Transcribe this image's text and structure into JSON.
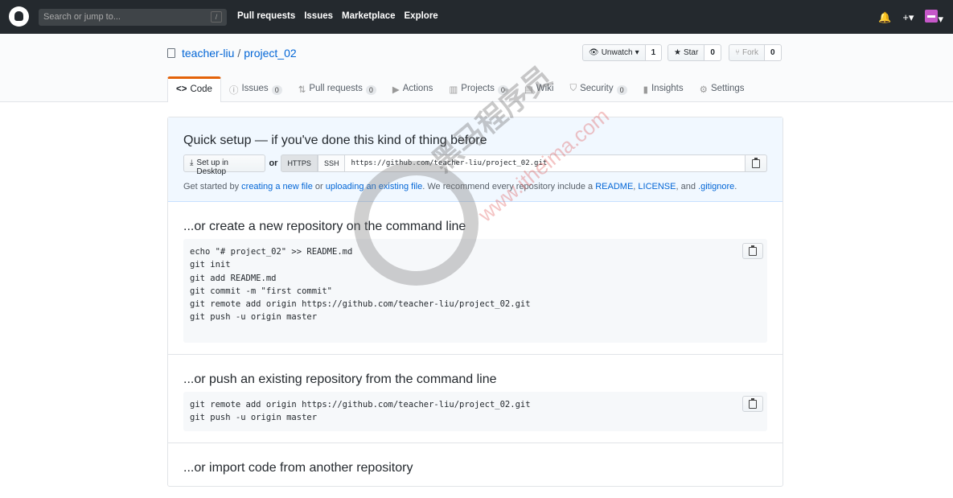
{
  "header": {
    "search_placeholder": "Search or jump to...",
    "slash_key": "/",
    "nav": [
      "Pull requests",
      "Issues",
      "Marketplace",
      "Explore"
    ],
    "icons": [
      "bell-icon",
      "plus-icon",
      "avatar"
    ]
  },
  "repo": {
    "owner": "teacher-liu",
    "separator": "/",
    "name": "project_02",
    "watch_label": "Unwatch",
    "watch_count": "1",
    "star_label": "Star",
    "star_count": "0",
    "fork_label": "Fork",
    "fork_count": "0"
  },
  "tabs": [
    {
      "icon": "<>",
      "label": "Code",
      "counter": ""
    },
    {
      "icon": "ⓘ",
      "label": "Issues",
      "counter": "0"
    },
    {
      "icon": "⇅",
      "label": "Pull requests",
      "counter": "0"
    },
    {
      "icon": "▶",
      "label": "Actions",
      "counter": ""
    },
    {
      "icon": "▥",
      "label": "Projects",
      "counter": "0"
    },
    {
      "icon": "▤",
      "label": "Wiki",
      "counter": ""
    },
    {
      "icon": "⛉",
      "label": "Security",
      "counter": "0"
    },
    {
      "icon": "▮",
      "label": "Insights",
      "counter": ""
    },
    {
      "icon": "⚙",
      "label": "Settings",
      "counter": ""
    }
  ],
  "setup": {
    "title": "Quick setup — if you've done this kind of thing before",
    "desktop_btn": "Set up in Desktop",
    "or": "or",
    "https": "HTTPS",
    "ssh": "SSH",
    "url": "https://github.com/teacher-liu/project_02.git",
    "hint_start": "Get started by ",
    "hint_link1": "creating a new file",
    "hint_mid1": " or ",
    "hint_link2": "uploading an existing file",
    "hint_mid2": ". We recommend every repository include a ",
    "hint_link3": "README",
    "hint_comma1": ", ",
    "hint_link4": "LICENSE",
    "hint_comma2": ", and ",
    "hint_link5": ".gitignore",
    "hint_end": "."
  },
  "sections": [
    {
      "title": "...or create a new repository on the command line",
      "lines": [
        "echo \"# project_02\" >> README.md",
        "git init",
        "git add README.md",
        "git commit -m \"first commit\"",
        "git remote add origin https://github.com/teacher-liu/project_02.git",
        "git push -u origin master"
      ]
    },
    {
      "title": "...or push an existing repository from the command line",
      "lines": [
        "git remote add origin https://github.com/teacher-liu/project_02.git",
        "git push -u origin master"
      ]
    },
    {
      "title": "...or import code from another repository",
      "lines": []
    }
  ],
  "watermark": {
    "text": "黑马程序员",
    "url": "www.itheima.com"
  }
}
